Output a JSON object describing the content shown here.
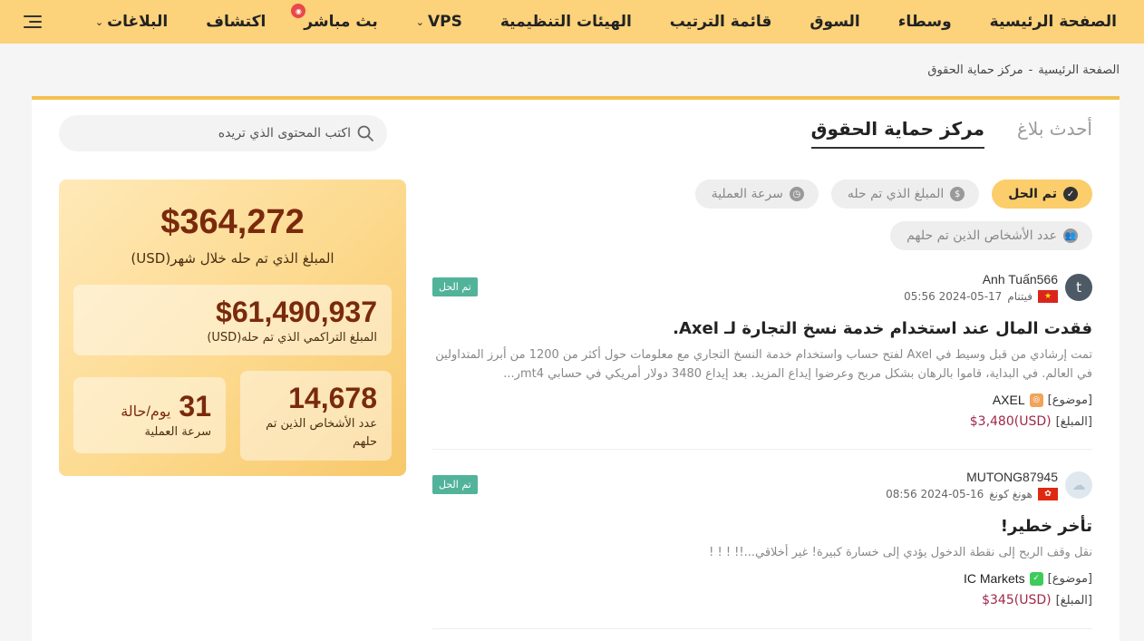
{
  "nav": {
    "items": [
      {
        "label": "الصفحة الرئيسية",
        "name": "nav-home"
      },
      {
        "label": "وسطاء",
        "name": "nav-brokers"
      },
      {
        "label": "السوق",
        "name": "nav-market"
      },
      {
        "label": "قائمة الترتيب",
        "name": "nav-ranking"
      },
      {
        "label": "الهيئات التنظيمية",
        "name": "nav-regulators"
      },
      {
        "label": "VPS",
        "name": "nav-vps",
        "dropdown": true
      },
      {
        "label": "بث مباشر",
        "name": "nav-live",
        "badge": true
      },
      {
        "label": "اكتشاف",
        "name": "nav-discover"
      },
      {
        "label": "البلاغات",
        "name": "nav-reports",
        "dropdown": true
      }
    ]
  },
  "breadcrumb": {
    "home": "الصفحة الرئيسية",
    "separator": "-",
    "current": "مركز حماية الحقوق"
  },
  "tabs": [
    {
      "label": "أحدث بلاغ",
      "active": false
    },
    {
      "label": "مركز حماية الحقوق",
      "active": true
    }
  ],
  "search": {
    "placeholder": "اكتب المحتوى الذي تريده"
  },
  "filters": [
    {
      "label": "تم الحل",
      "active": true,
      "icon": "check-circle-icon",
      "glyph": "✓"
    },
    {
      "label": "المبلغ الذي تم حله",
      "active": false,
      "icon": "dollar-icon",
      "glyph": "$"
    },
    {
      "label": "سرعة العملية",
      "active": false,
      "icon": "clock-icon",
      "glyph": "◷"
    },
    {
      "label": "عدد الأشخاص الذين تم حلهم",
      "active": false,
      "icon": "users-icon",
      "glyph": "👥"
    }
  ],
  "complaints": [
    {
      "avatar_letter": "t",
      "user": "Anh Tuấn566",
      "country": "فيتنام",
      "date": "2024-05-17 05:56",
      "status": "تم الحل",
      "title": "فقدت المال عند استخدام خدمة نسخ التجارة لـ Axel.",
      "description": "تمت إرشادي من قبل وسيط في Axel لفتح حساب واستخدام خدمة النسخ التجاري مع معلومات حول أكثر من 1200 من أبرز المتداولين في العالم. في البداية، قاموا بالرهان بشكل مربح وعرضوا إيداع المزيد. بعد إيداع 3480 دولار أمريكي في حسابي mt4ر...",
      "subject_label": "[موضوع]",
      "broker": "AXEL",
      "amount_label": "[المبلغ]",
      "amount": "(USD)$3,480"
    },
    {
      "avatar_letter": "☁",
      "user": "MUTONG87945",
      "country": "هونغ كونغ",
      "date": "2024-05-16 08:56",
      "status": "تم الحل",
      "title": "تأخر خطير!",
      "description": "نقل وقف الربح إلى نقطة الدخول يؤدي إلى خسارة كبيرة! غير أخلاقي...!! ! ! !",
      "subject_label": "[موضوع]",
      "broker": "IC Markets",
      "amount_label": "[المبلغ]",
      "amount": "(USD)$345"
    }
  ],
  "stats": {
    "month_amount": "$364,272",
    "month_label": "المبلغ الذي تم حله خلال شهر(USD)",
    "cumulative_amount": "$61,490,937",
    "cumulative_label": "المبلغ التراكمي الذي تم حله(USD)",
    "people_count": "14,678",
    "people_label": "عدد الأشخاص الذين تم حلهم",
    "speed_value": "31",
    "speed_unit": "يوم/حالة",
    "speed_label": "سرعة العملية"
  },
  "colors": {
    "nav_bg": "#fcd27a",
    "accent": "#f2c14e",
    "resolved_tag": "#52b39b",
    "amount": "#a0284a"
  }
}
